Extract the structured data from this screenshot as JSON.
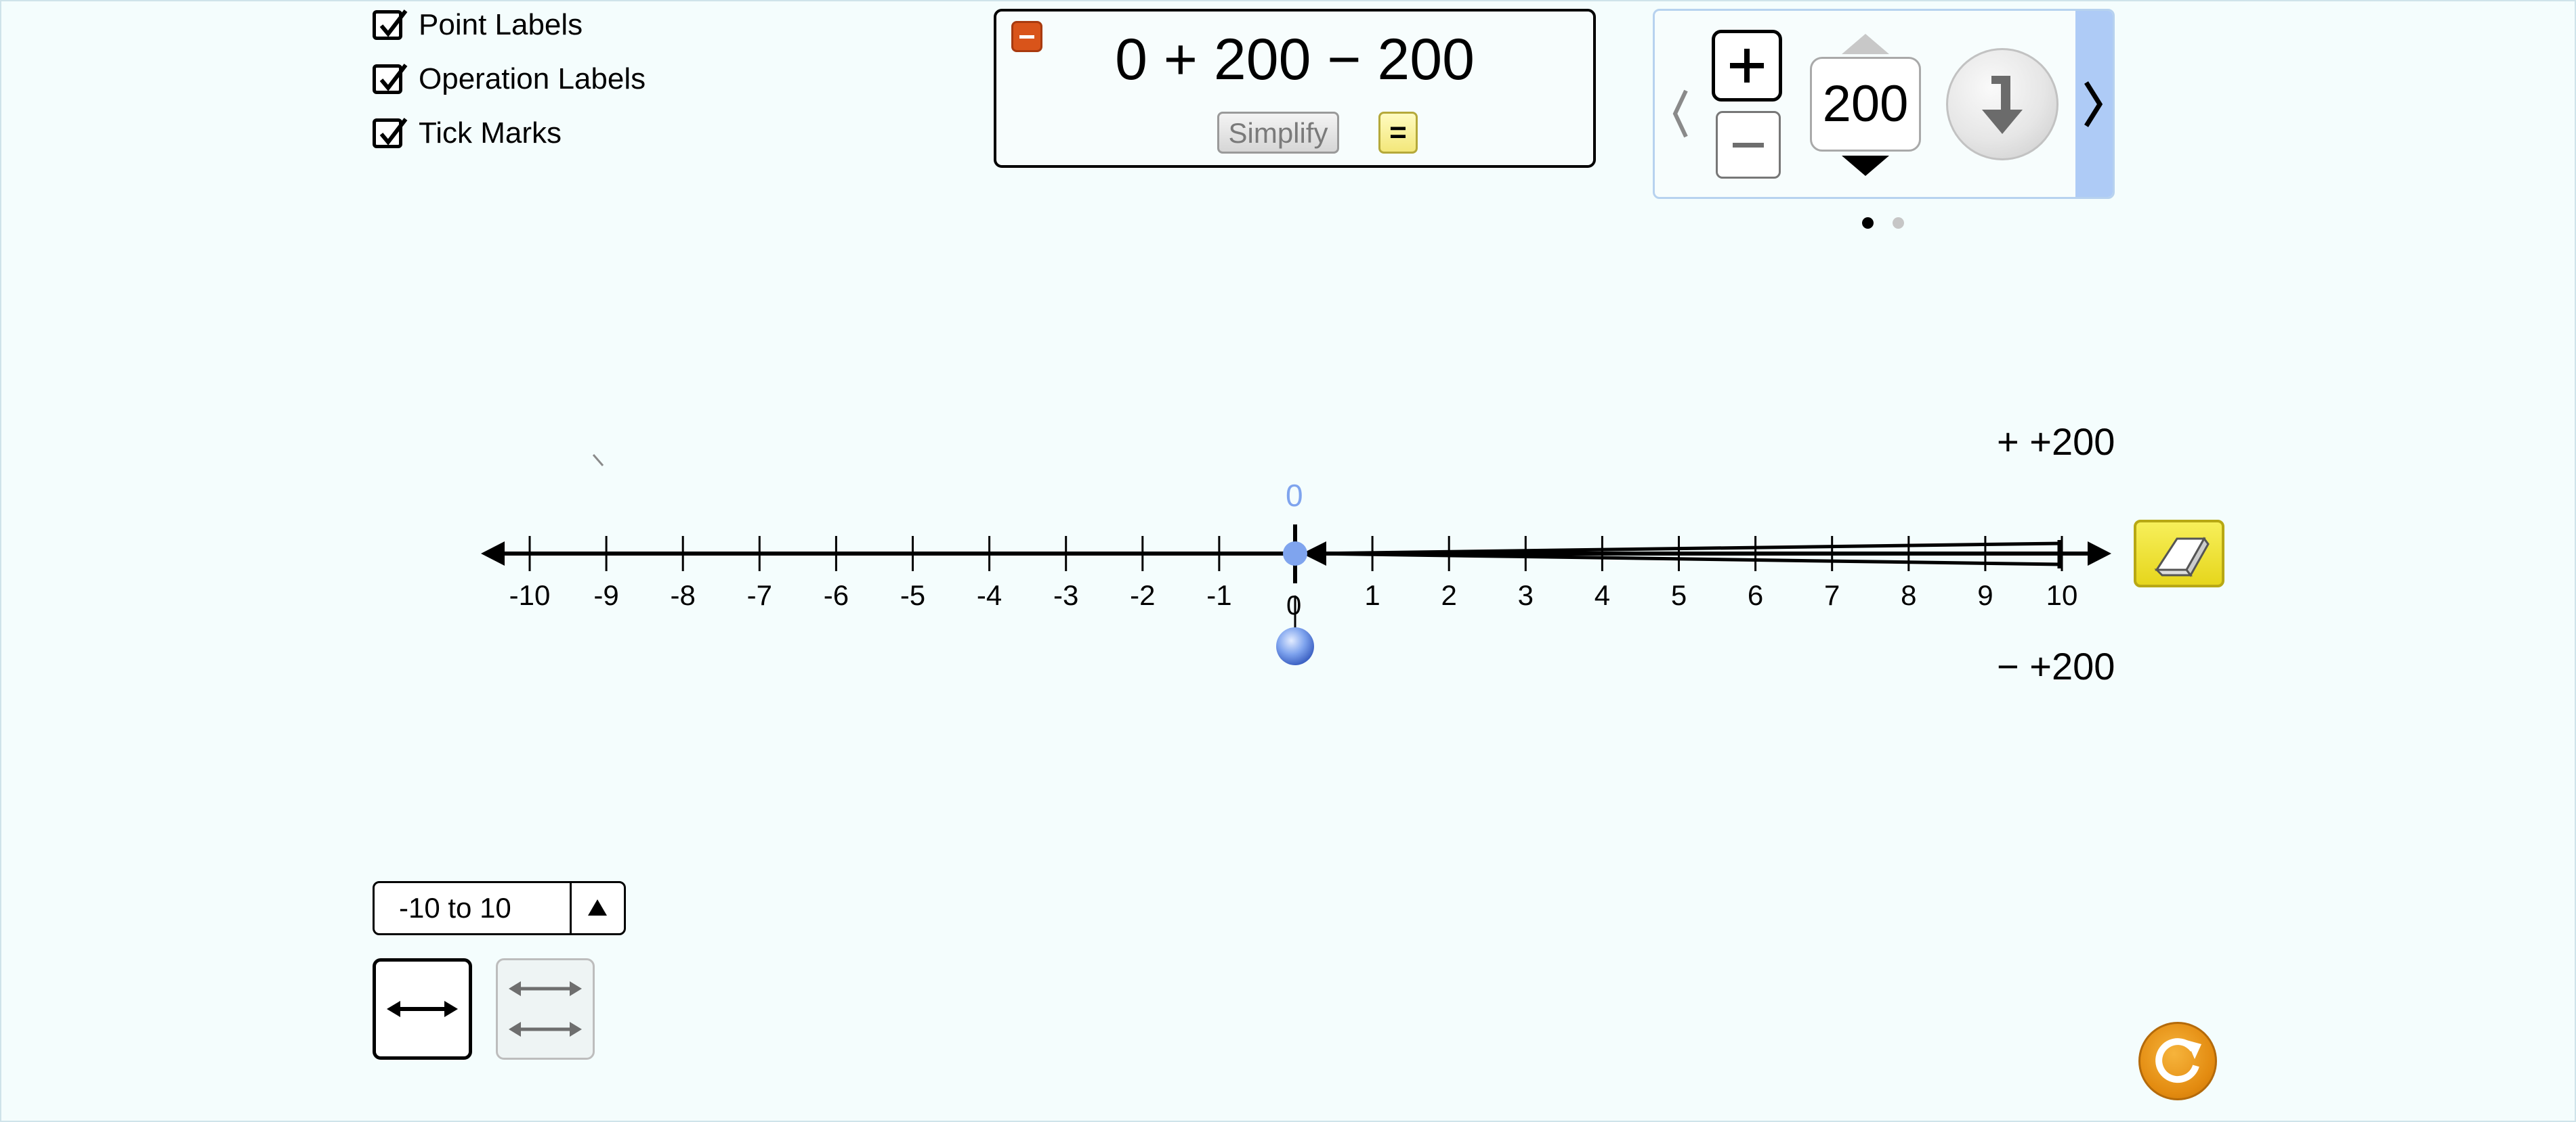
{
  "options": {
    "point_labels": "Point Labels",
    "operation_labels": "Operation Labels",
    "tick_marks": "Tick Marks"
  },
  "equation": {
    "expression": "0 + 200 − 200",
    "simplify_label": "Simplify",
    "equals_label": "="
  },
  "operation_panel": {
    "value": "200",
    "page_count": 2,
    "current_page": 1
  },
  "number_line": {
    "ticks": [
      "-10",
      "-9",
      "-8",
      "-7",
      "-6",
      "-5",
      "-4",
      "-3",
      "-2",
      "-1",
      "0",
      "1",
      "2",
      "3",
      "4",
      "5",
      "6",
      "7",
      "8",
      "9",
      "10"
    ],
    "point_value_label": "0",
    "point_below_label": "0",
    "op_plus_label": "+ +200",
    "op_minus_label": "− +200"
  },
  "range_selector": {
    "selected": "-10 to 10"
  },
  "colors": {
    "background": "#f4fdfd",
    "point_blue": "#7fa4ee",
    "eraser_yellow": "#f0e42e",
    "reset_orange": "#e38b10",
    "carousel_accent": "#aecbf6"
  }
}
